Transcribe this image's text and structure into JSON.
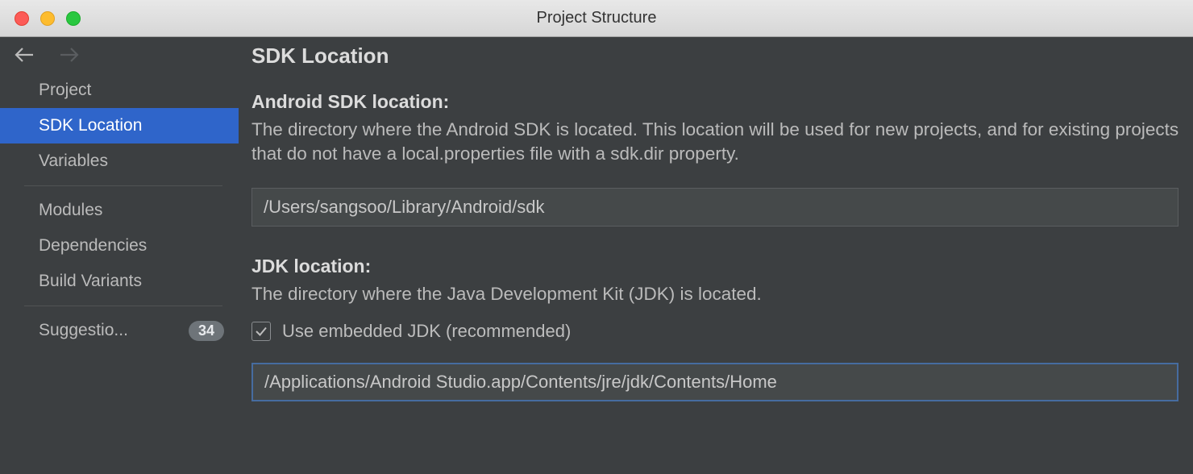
{
  "window": {
    "title": "Project Structure"
  },
  "sidebar": {
    "items": [
      {
        "label": "Project"
      },
      {
        "label": "SDK Location"
      },
      {
        "label": "Variables"
      },
      {
        "label": "Modules"
      },
      {
        "label": "Dependencies"
      },
      {
        "label": "Build Variants"
      },
      {
        "label": "Suggestio...",
        "badge": "34"
      }
    ]
  },
  "page": {
    "title": "SDK Location",
    "sdk": {
      "label": "Android SDK location:",
      "desc": "The directory where the Android SDK is located. This location will be used for new projects, and for existing projects that do not have a local.properties file with a sdk.dir property.",
      "value": "/Users/sangsoo/Library/Android/sdk"
    },
    "jdk": {
      "label": "JDK location:",
      "desc": "The directory where the Java Development Kit (JDK) is located.",
      "checkbox_label": "Use embedded JDK (recommended)",
      "checked": true,
      "value": "/Applications/Android Studio.app/Contents/jre/jdk/Contents/Home"
    }
  }
}
